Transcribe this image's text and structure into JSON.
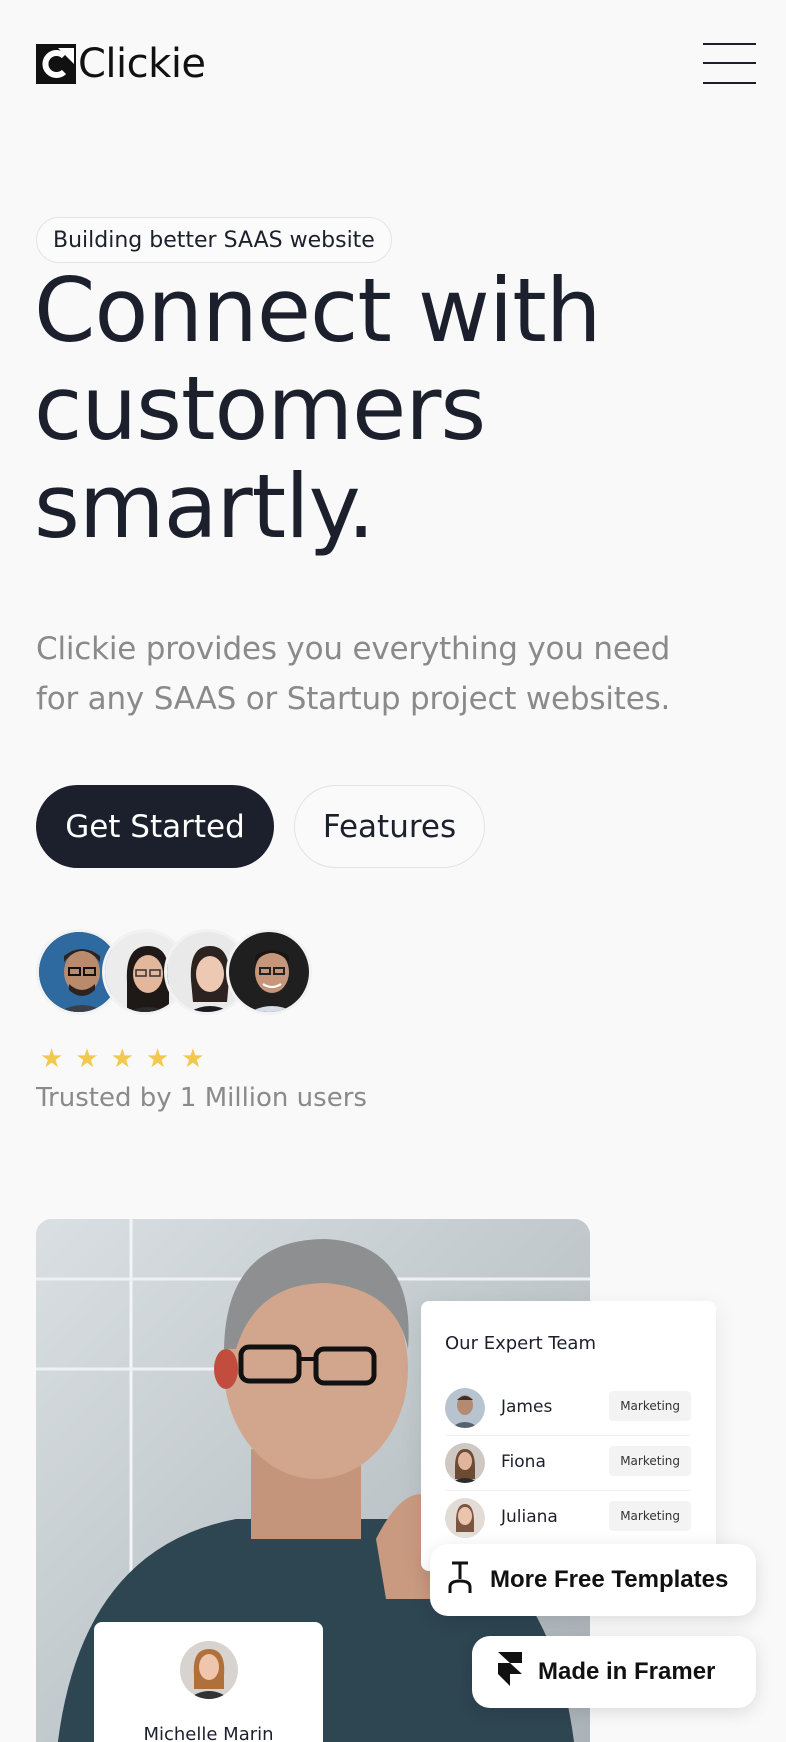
{
  "header": {
    "logo_text": "Clickie",
    "logo_icon": "clickie-logo-icon",
    "menu_icon": "hamburger-menu-icon"
  },
  "hero": {
    "badge": "Building better SAAS website",
    "headline_line1": "Connect with",
    "headline_line2": "customers",
    "headline_line3": "smartly.",
    "subtext_line1": "Clickie provides you everything you need",
    "subtext_line2": "for any SAAS or Startup project websites.",
    "primary_button": "Get Started",
    "secondary_button": "Features",
    "rating": 5,
    "trusted_text": "Trusted by 1 Million users"
  },
  "showcase": {
    "team_card": {
      "title": "Our Expert Team",
      "members": [
        {
          "name": "James",
          "role": "Marketing"
        },
        {
          "name": "Fiona",
          "role": "Marketing"
        },
        {
          "name": "Juliana",
          "role": "Marketing"
        }
      ]
    },
    "person_card": {
      "name": "Michelle Marin"
    }
  },
  "badges": {
    "templates": "More Free Templates",
    "framer": "Made in Framer"
  },
  "colors": {
    "background": "#f9f9f9",
    "primary": "#1b202c",
    "muted_text": "#8a8a8a",
    "star": "#f2c94c"
  }
}
